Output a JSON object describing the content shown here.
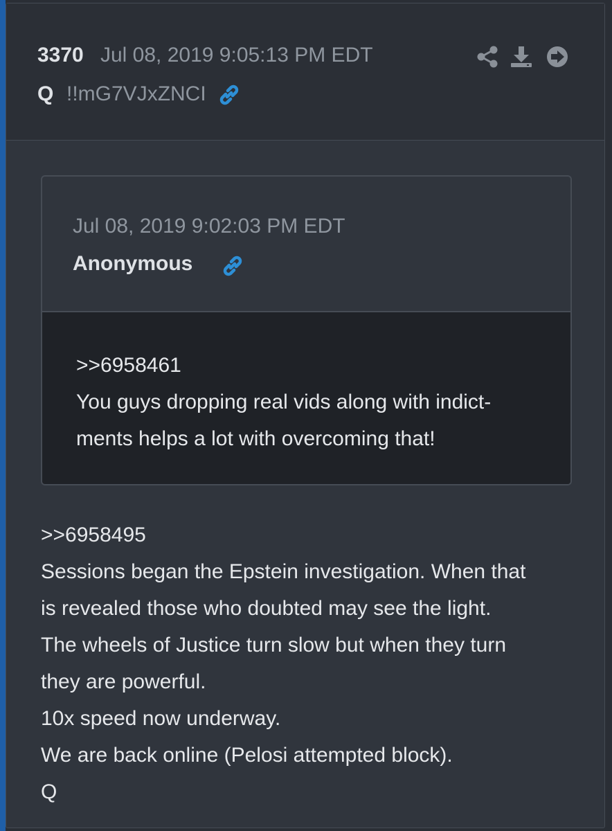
{
  "post": {
    "number": "3370",
    "timestamp": "Jul 08, 2019 9:05:13 PM EDT",
    "author": "Q",
    "tripcode": "!!mG7VJxZNCI"
  },
  "header_actions": {
    "share_icon": "share-icon",
    "download_icon": "download-icon",
    "goto_icon": "arrow-right-circle-icon"
  },
  "quoted_post": {
    "timestamp": "Jul 08, 2019 9:02:03 PM EDT",
    "author": "Anonymous",
    "body_lines": [
      ">>6958461",
      "You guys dropping real vids along with indict-",
      "ments helps a lot with overcoming that!"
    ]
  },
  "message": {
    "lines": [
      ">>6958495",
      "Sessions began the Epstein investigation. When that",
      "is revealed those who doubted may see the light.",
      "The wheels of Justice turn slow but when they turn",
      "they are powerful.",
      "10x speed now underway.",
      "We are back online (Pelosi attempted block).",
      "Q"
    ]
  },
  "colors": {
    "accent": "#1f5fa8",
    "link_icon": "#2d8fd6",
    "muted_text": "#8f969f",
    "card_bg": "#30353d",
    "quote_body_bg": "#1f2227"
  }
}
